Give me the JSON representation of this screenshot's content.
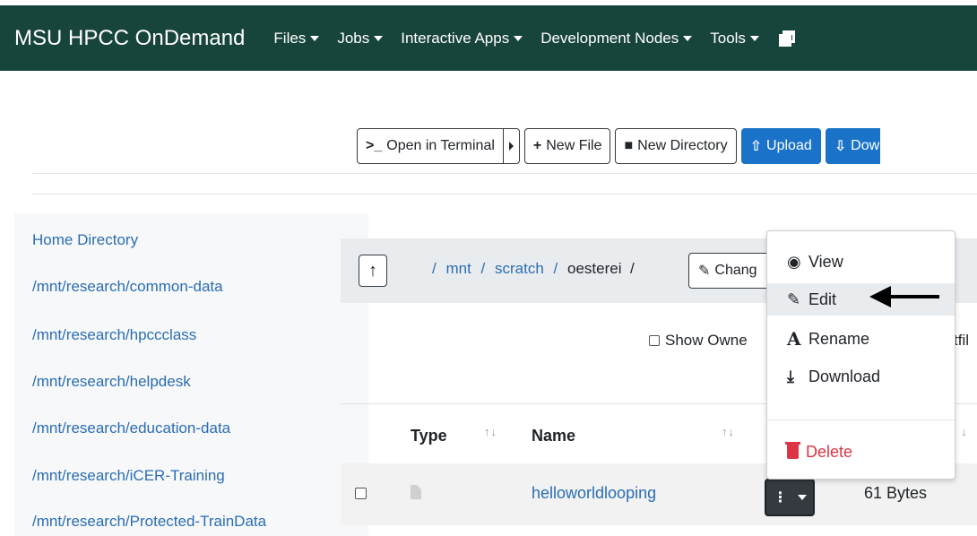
{
  "navbar": {
    "brand": "MSU HPCC OnDemand",
    "items": [
      "Files",
      "Jobs",
      "Interactive Apps",
      "Development Nodes",
      "Tools"
    ],
    "bg_color": "#18453b"
  },
  "toolbar": {
    "open_terminal": "Open in Terminal",
    "new_file": "New File",
    "new_directory": "New Directory",
    "upload": "Upload",
    "download": "Dow"
  },
  "sidebar": {
    "items": [
      "Home Directory",
      "/mnt/research/common-data",
      "/mnt/research/hpccclass",
      "/mnt/research/helpdesk",
      "/mnt/research/education-data",
      "/mnt/research/iCER-Training",
      "/mnt/research/Protected-TrainData"
    ]
  },
  "path": {
    "segments": [
      "mnt",
      "scratch"
    ],
    "current": "oesterei",
    "change_label": "Chang"
  },
  "options": {
    "show_owner": "Show Owne",
    "dotfiles": "tfil"
  },
  "table": {
    "col_type": "Type",
    "col_name": "Name",
    "rows": [
      {
        "name": "helloworldlooping",
        "size": "61 Bytes"
      }
    ]
  },
  "menu": {
    "view": "View",
    "edit": "Edit",
    "rename": "Rename",
    "download": "Download",
    "delete": "Delete"
  }
}
